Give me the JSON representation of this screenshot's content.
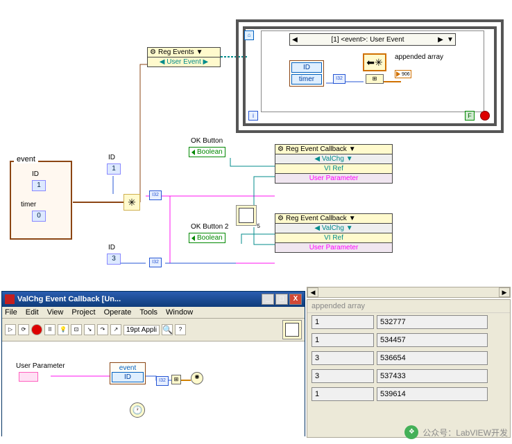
{
  "cluster": {
    "label": "event",
    "field_id": {
      "label": "ID",
      "value": "1"
    },
    "field_timer": {
      "label": "timer",
      "value": "0"
    }
  },
  "id_constants": {
    "id1_label": "ID",
    "id1_value": "1",
    "id2_label": "ID",
    "id2_value": "3"
  },
  "reg_events": {
    "title": "Reg Events",
    "row1": "User Event"
  },
  "event_case": {
    "selector": "[1] <event>: User Event",
    "id_label": "ID",
    "timer_label": "timer",
    "indicator": "appended array"
  },
  "ok1": {
    "label": "OK Button",
    "type": "Boolean"
  },
  "ok2": {
    "label": "OK Button 2",
    "type": "Boolean"
  },
  "reg_cb1": {
    "title": "Reg Event Callback",
    "r1": "ValChg",
    "r2": "VI Ref",
    "r3": "User Parameter"
  },
  "reg_cb2": {
    "title": "Reg Event Callback",
    "r1": "ValChg",
    "r2": "VI Ref",
    "r3": "User Parameter"
  },
  "loop": {
    "stop_terminal": "F"
  },
  "vi_window": {
    "title": "ValChg Event Callback [Un...",
    "menu": [
      "File",
      "Edit",
      "View",
      "Project",
      "Operate",
      "Tools",
      "Window"
    ],
    "font_select": "19pt Appli",
    "user_param_label": "User Parameter",
    "cluster_label": "event",
    "id_label": "ID"
  },
  "array_out": {
    "label": "appended array",
    "rows": [
      {
        "idx": "1",
        "val": "532777"
      },
      {
        "idx": "1",
        "val": "534457"
      },
      {
        "idx": "3",
        "val": "536654"
      },
      {
        "idx": "3",
        "val": "537433"
      },
      {
        "idx": "1",
        "val": "539614"
      }
    ]
  },
  "watermark": {
    "text": "公众号：LabVIEW开发"
  }
}
